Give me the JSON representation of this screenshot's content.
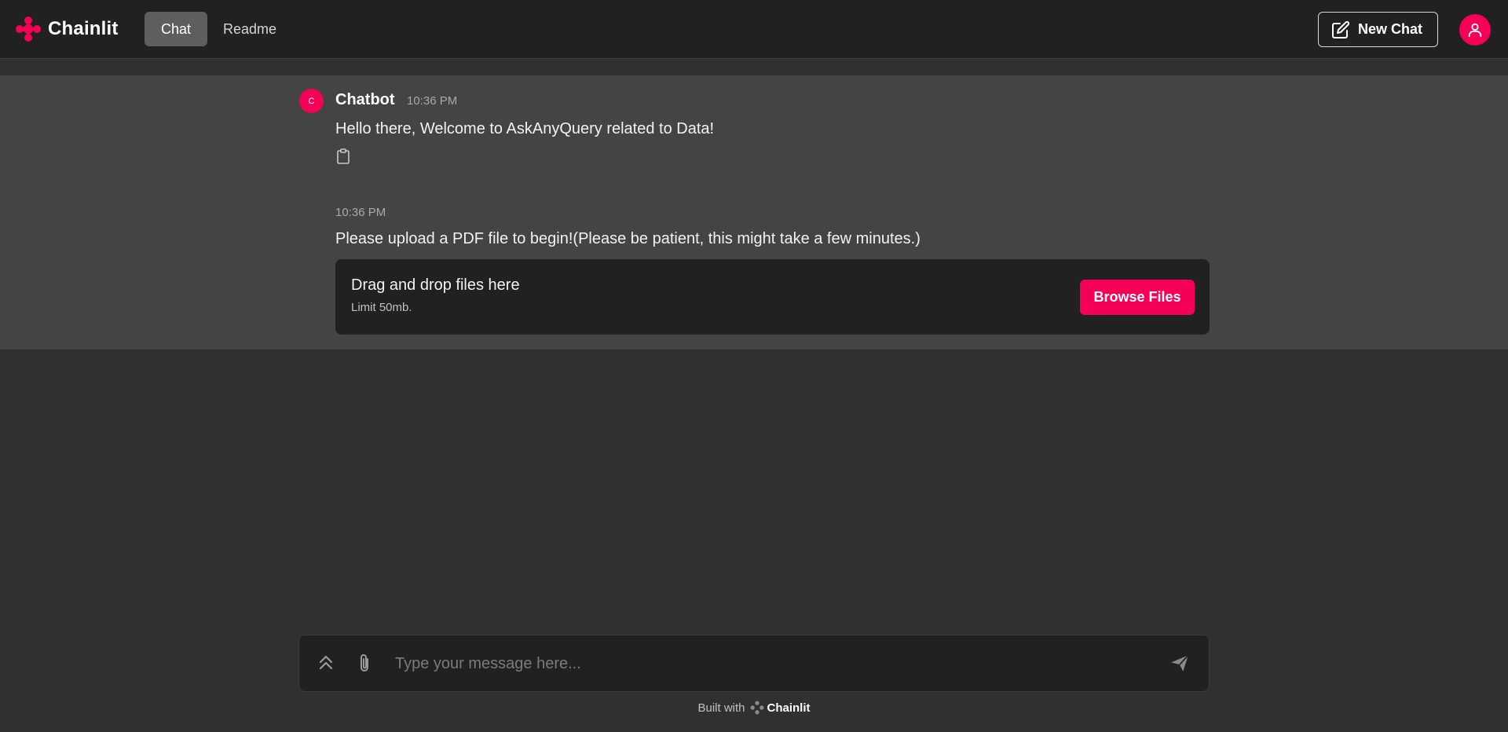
{
  "header": {
    "logo_text": "Chainlit",
    "tabs": [
      {
        "label": "Chat",
        "active": true
      },
      {
        "label": "Readme",
        "active": false
      }
    ],
    "new_chat_label": "New Chat"
  },
  "messages": [
    {
      "author": "Chatbot",
      "avatar_letter": "C",
      "time": "10:36 PM",
      "text": "Hello there, Welcome to AskAnyQuery related to Data!"
    },
    {
      "time": "10:36 PM",
      "text": "Please upload a PDF file to begin!(Please be patient, this might take a few minutes.)"
    }
  ],
  "upload": {
    "title": "Drag and drop files here",
    "limit": "Limit 50mb.",
    "button_label": "Browse Files"
  },
  "composer": {
    "placeholder": "Type your message here..."
  },
  "footer": {
    "built_with": "Built with",
    "brand": "Chainlit"
  },
  "colors": {
    "accent": "#f50057",
    "header_bg": "#212121",
    "page_bg": "#303030",
    "message_band_bg": "#444444"
  },
  "icons": [
    "chainlit-logo-icon",
    "edit-icon",
    "user-icon",
    "clipboard-icon",
    "chevrons-up-icon",
    "paperclip-icon",
    "send-icon"
  ]
}
